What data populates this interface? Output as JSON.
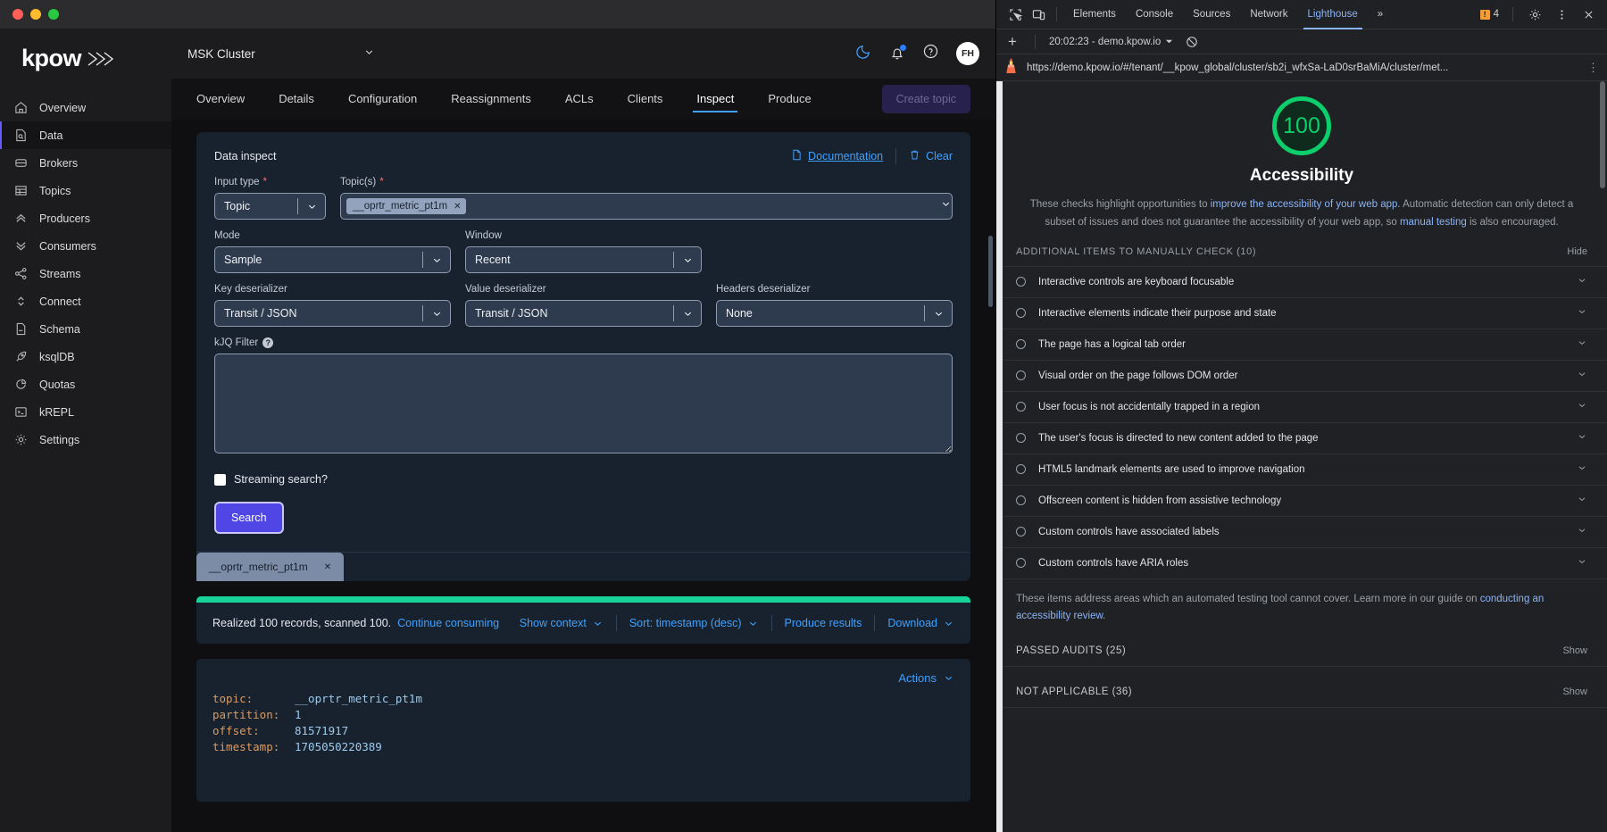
{
  "sidebar": {
    "logo": "kpow",
    "items": [
      {
        "label": "Overview",
        "icon": "home-icon",
        "active": false
      },
      {
        "label": "Data",
        "icon": "data-file-icon",
        "active": true
      },
      {
        "label": "Brokers",
        "icon": "broker-icon",
        "active": false
      },
      {
        "label": "Topics",
        "icon": "table-icon",
        "active": false
      },
      {
        "label": "Producers",
        "icon": "chevrons-up-icon",
        "active": false
      },
      {
        "label": "Consumers",
        "icon": "chevrons-down-icon",
        "active": false
      },
      {
        "label": "Streams",
        "icon": "share-icon",
        "active": false
      },
      {
        "label": "Connect",
        "icon": "chevrons-updown-icon",
        "active": false
      },
      {
        "label": "Schema",
        "icon": "document-icon",
        "active": false
      },
      {
        "label": "ksqlDB",
        "icon": "rocket-icon",
        "active": false
      },
      {
        "label": "Quotas",
        "icon": "pie-chart-icon",
        "active": false
      },
      {
        "label": "kREPL",
        "icon": "terminal-icon",
        "active": false
      },
      {
        "label": "Settings",
        "icon": "gear-icon",
        "active": false
      }
    ]
  },
  "topbar": {
    "cluster": "MSK Cluster",
    "avatar_initials": "FH"
  },
  "tabs": [
    {
      "label": "Overview",
      "active": false
    },
    {
      "label": "Details",
      "active": false
    },
    {
      "label": "Configuration",
      "active": false
    },
    {
      "label": "Reassignments",
      "active": false
    },
    {
      "label": "ACLs",
      "active": false
    },
    {
      "label": "Clients",
      "active": false
    },
    {
      "label": "Inspect",
      "active": true
    },
    {
      "label": "Produce",
      "active": false
    }
  ],
  "create_topic_label": "Create topic",
  "inspect": {
    "title": "Data inspect",
    "documentation_label": "Documentation",
    "clear_label": "Clear",
    "input_type": {
      "label": "Input type",
      "required": true,
      "value": "Topic"
    },
    "topics": {
      "label": "Topic(s)",
      "required": true,
      "chip": "__oprtr_metric_pt1m"
    },
    "mode": {
      "label": "Mode",
      "value": "Sample"
    },
    "window": {
      "label": "Window",
      "value": "Recent"
    },
    "key_deserializer": {
      "label": "Key deserializer",
      "value": "Transit / JSON"
    },
    "value_deserializer": {
      "label": "Value deserializer",
      "value": "Transit / JSON"
    },
    "headers_deserializer": {
      "label": "Headers deserializer",
      "value": "None"
    },
    "kjq_filter": {
      "label": "kJQ Filter",
      "value": ""
    },
    "streaming_search_label": "Streaming search?",
    "search_label": "Search",
    "topic_tab": "__oprtr_metric_pt1m"
  },
  "results": {
    "summary": "Realized 100 records, scanned 100.",
    "continue_label": "Continue consuming",
    "show_context": "Show context",
    "sort": "Sort: timestamp (desc)",
    "produce_results": "Produce results",
    "download": "Download"
  },
  "record": {
    "actions_label": "Actions",
    "fields": [
      {
        "key": "topic:",
        "value": "__oprtr_metric_pt1m"
      },
      {
        "key": "partition:",
        "value": "1"
      },
      {
        "key": "offset:",
        "value": "81571917"
      },
      {
        "key": "timestamp:",
        "value": "1705050220389"
      }
    ]
  },
  "devtools": {
    "tabs": [
      {
        "label": "Elements",
        "active": false
      },
      {
        "label": "Console",
        "active": false
      },
      {
        "label": "Sources",
        "active": false
      },
      {
        "label": "Network",
        "active": false
      },
      {
        "label": "Lighthouse",
        "active": true
      }
    ],
    "more_label": "»",
    "warning_count": "4",
    "run_label": "20:02:23 - demo.kpow.io",
    "url": "https://demo.kpow.io/#/tenant/__kpow_global/cluster/sb2i_wfxSa-LaD0srBaMiA/cluster/met...",
    "lighthouse": {
      "score": "100",
      "category": "Accessibility",
      "description_parts": [
        {
          "text": "These checks highlight opportunities to ",
          "link": false
        },
        {
          "text": "improve the accessibility of your web app",
          "link": true
        },
        {
          "text": ". Automatic detection can only detect a subset of issues and does not guarantee the accessibility of your web app, so ",
          "link": false
        },
        {
          "text": "manual testing",
          "link": true
        },
        {
          "text": " is also encouraged.",
          "link": false
        }
      ],
      "manual_section": {
        "title": "ADDITIONAL ITEMS TO MANUALLY CHECK (10)",
        "action": "Hide"
      },
      "manual_items": [
        "Interactive controls are keyboard focusable",
        "Interactive elements indicate their purpose and state",
        "The page has a logical tab order",
        "Visual order on the page follows DOM order",
        "User focus is not accidentally trapped in a region",
        "The user's focus is directed to new content added to the page",
        "HTML5 landmark elements are used to improve navigation",
        "Offscreen content is hidden from assistive technology",
        "Custom controls have associated labels",
        "Custom controls have ARIA roles"
      ],
      "footnote_prefix": "These items address areas which an automated testing tool cannot cover. Learn more in our guide on ",
      "footnote_link": "conducting an accessibility review",
      "footnote_suffix": ".",
      "passed_audits": {
        "title": "PASSED AUDITS (25)",
        "action": "Show"
      },
      "not_applicable": {
        "title": "NOT APPLICABLE (36)",
        "action": "Show"
      }
    }
  },
  "colors": {
    "accent_purple": "#4f46e5",
    "link_blue": "#3ea1ff",
    "success_green": "#18d49a",
    "lighthouse_green": "#0cce6b",
    "devtools_blue": "#8ab4f8"
  }
}
